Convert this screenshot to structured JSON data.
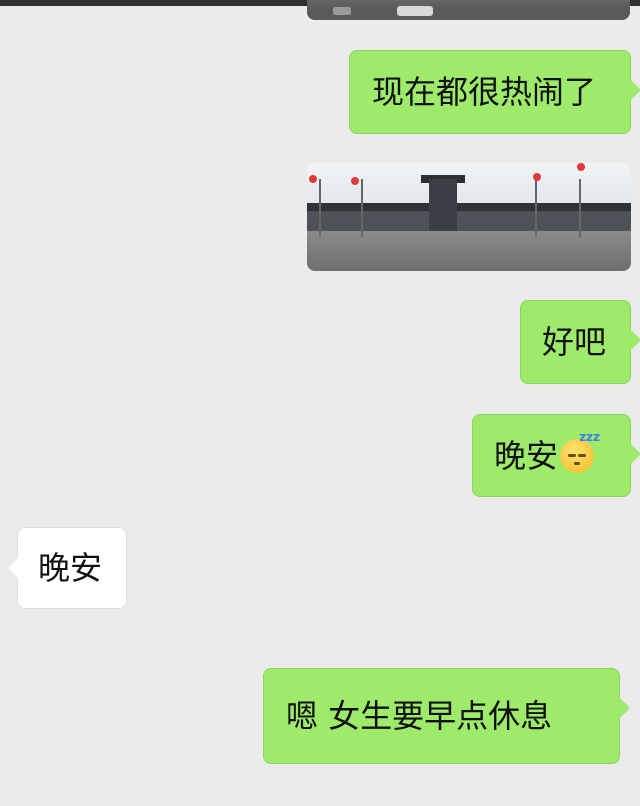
{
  "messages": [
    {
      "id": "m1",
      "side": "right",
      "type": "image",
      "text": ""
    },
    {
      "id": "m2",
      "side": "right",
      "type": "text",
      "text": "现在都很热闹了"
    },
    {
      "id": "m3",
      "side": "right",
      "type": "image",
      "text": ""
    },
    {
      "id": "m4",
      "side": "right",
      "type": "text",
      "text": "好吧"
    },
    {
      "id": "m5",
      "side": "right",
      "type": "text",
      "text": "晚安",
      "emoji": "sleeping-face"
    },
    {
      "id": "m6",
      "side": "left",
      "type": "text",
      "text": "晚安"
    },
    {
      "id": "m7",
      "side": "right",
      "type": "text",
      "text": "嗯 女生要早点休息"
    }
  ],
  "colors": {
    "background": "#ebebeb",
    "sent_bubble": "#9eea6a",
    "received_bubble": "#ffffff"
  }
}
